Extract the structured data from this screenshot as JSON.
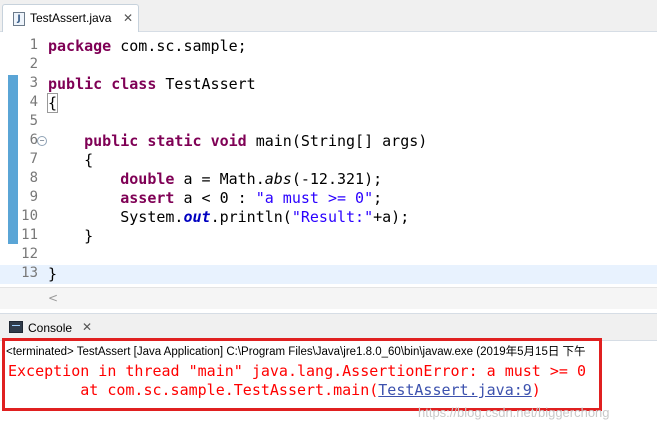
{
  "editor": {
    "tab": {
      "label": "TestAssert.java",
      "close": "✕",
      "icon": "java-file-icon"
    },
    "lines": [
      {
        "num": "1",
        "tokens": [
          [
            "kw",
            "package"
          ],
          [
            "p",
            " com.sc.sample;"
          ]
        ]
      },
      {
        "num": "2",
        "tokens": []
      },
      {
        "num": "3",
        "tokens": [
          [
            "kw",
            "public"
          ],
          [
            "p",
            " "
          ],
          [
            "kw",
            "class"
          ],
          [
            "p",
            " TestAssert"
          ]
        ]
      },
      {
        "num": "4",
        "tokens": [
          [
            "box",
            "{"
          ]
        ]
      },
      {
        "num": "5",
        "tokens": []
      },
      {
        "num": "6",
        "fold": "−",
        "tokens": [
          [
            "p",
            "    "
          ],
          [
            "kw",
            "public"
          ],
          [
            "p",
            " "
          ],
          [
            "kw",
            "static"
          ],
          [
            "p",
            " "
          ],
          [
            "kw",
            "void"
          ],
          [
            "p",
            " main(String[] args)"
          ]
        ]
      },
      {
        "num": "7",
        "tokens": [
          [
            "p",
            "    {"
          ]
        ]
      },
      {
        "num": "8",
        "tokens": [
          [
            "p",
            "        "
          ],
          [
            "kw",
            "double"
          ],
          [
            "p",
            " a = Math."
          ],
          [
            "mth",
            "abs"
          ],
          [
            "p",
            "(-12.321);"
          ]
        ]
      },
      {
        "num": "9",
        "tokens": [
          [
            "p",
            "        "
          ],
          [
            "kw",
            "assert"
          ],
          [
            "p",
            " a < 0 : "
          ],
          [
            "str",
            "\"a must >= 0\""
          ],
          [
            "p",
            ";"
          ]
        ]
      },
      {
        "num": "10",
        "tokens": [
          [
            "p",
            "        System."
          ],
          [
            "stat",
            "out"
          ],
          [
            "p",
            ".println("
          ],
          [
            "str",
            "\"Result:\""
          ],
          [
            "p",
            "+a);"
          ]
        ]
      },
      {
        "num": "11",
        "tokens": [
          [
            "p",
            "    }"
          ]
        ]
      },
      {
        "num": "12",
        "tokens": []
      },
      {
        "num": "13",
        "tokens": [
          [
            "p",
            "}"
          ]
        ]
      }
    ],
    "scroll_left": "<"
  },
  "console": {
    "tab_label": "Console",
    "close": "✕",
    "icon": "console-icon",
    "terminated": "<terminated> TestAssert [Java Application] C:\\Program Files\\Java\\jre1.8.0_60\\bin\\javaw.exe (2019年5月15日 下午",
    "error_line1": "Exception in thread \"main\" java.lang.AssertionError: a must >= 0",
    "error_line2_prefix": "        at com.sc.sample.TestAssert.main(",
    "error_link": "TestAssert.java:9",
    "error_line2_suffix": ")"
  },
  "watermark": "https://blog.csdn.net/biggerchong",
  "colors": {
    "keyword": "#7f0055",
    "string": "#2a00ff",
    "error": "#ff0000",
    "highlight_box": "#e02020",
    "link": "#3d52ae"
  }
}
